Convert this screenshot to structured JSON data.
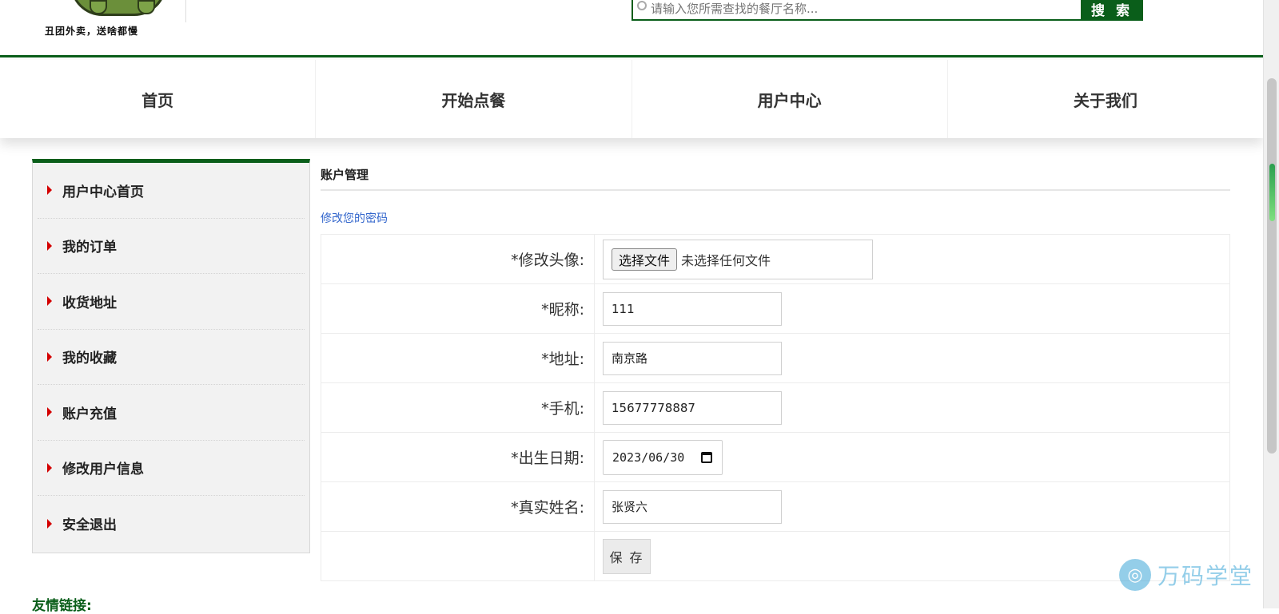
{
  "header": {
    "logo_text": "丑团外卖，送啥都慢",
    "search_placeholder": "请输入您所需查找的餐厅名称...",
    "search_button": "搜 索"
  },
  "nav": {
    "items": [
      {
        "label": "首页"
      },
      {
        "label": "开始点餐"
      },
      {
        "label": "用户中心"
      },
      {
        "label": "关于我们"
      }
    ]
  },
  "sidebar": {
    "items": [
      {
        "label": "用户中心首页"
      },
      {
        "label": "我的订单"
      },
      {
        "label": "收货地址"
      },
      {
        "label": "我的收藏"
      },
      {
        "label": "账户充值"
      },
      {
        "label": "修改用户信息"
      },
      {
        "label": "安全退出"
      }
    ]
  },
  "main": {
    "title": "账户管理",
    "change_password_link": "修改您的密码",
    "form": {
      "avatar_label": "*修改头像:",
      "file_button": "选择文件",
      "file_status": "未选择任何文件",
      "nickname_label": "*昵称:",
      "nickname_value": "111",
      "address_label": "*地址:",
      "address_value": "南京路",
      "phone_label": "*手机:",
      "phone_value": "15677778887",
      "birthday_label": "*出生日期:",
      "birthday_value": "2023/06/30",
      "realname_label": "*真实姓名:",
      "realname_value": "张贤六",
      "save_button": "保 存"
    }
  },
  "footer": {
    "links_title": "友情链接:"
  },
  "watermark": {
    "text": "万码学堂"
  },
  "colors": {
    "brand_green": "#0a5e1a",
    "link_blue": "#3366cc",
    "bullet_red": "#d40000"
  }
}
